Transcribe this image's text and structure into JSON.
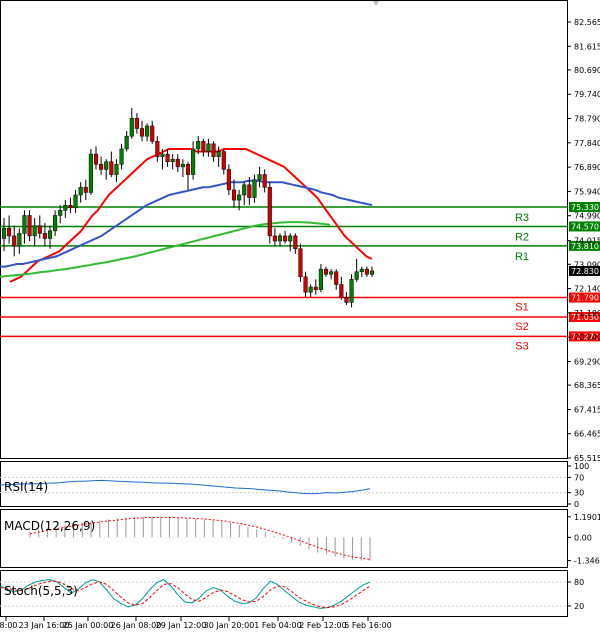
{
  "chart_data": [
    {
      "type": "candlestick",
      "title": "",
      "ylim": [
        65.515,
        83.0
      ],
      "grid": false,
      "price_axis_ticks": [
        "82.565",
        "81.615",
        "80.690",
        "79.740",
        "78.790",
        "77.840",
        "76.890",
        "75.940",
        "74.990",
        "74.015",
        "73.090",
        "72.140",
        "71.190",
        "70.240",
        "69.290",
        "68.365",
        "67.415",
        "66.465",
        "65.515"
      ],
      "time_axis_ticks": [
        "08:00",
        "23 Jan 16:00",
        "25 Jan 00:00",
        "26 Jan 08:00",
        "29 Jan 12:00",
        "30 Jan 20:00",
        "1 Feb 04:00",
        "2 Feb 12:00",
        "5 Feb 16:00"
      ],
      "candles": [
        [
          74.1,
          74.9,
          73.6,
          74.5
        ],
        [
          74.5,
          75.0,
          73.9,
          74.2
        ],
        [
          74.2,
          74.6,
          73.4,
          73.8
        ],
        [
          73.8,
          74.5,
          73.5,
          74.3
        ],
        [
          74.3,
          75.2,
          73.9,
          75.0
        ],
        [
          75.0,
          75.2,
          74.0,
          74.2
        ],
        [
          74.2,
          74.9,
          73.8,
          74.6
        ],
        [
          74.6,
          75.0,
          74.1,
          74.3
        ],
        [
          74.3,
          74.7,
          73.8,
          74.1
        ],
        [
          74.1,
          74.6,
          73.7,
          74.4
        ],
        [
          74.4,
          75.2,
          74.2,
          75.0
        ],
        [
          75.0,
          75.4,
          74.7,
          75.2
        ],
        [
          75.2,
          75.6,
          74.9,
          75.4
        ],
        [
          75.4,
          75.7,
          75.1,
          75.3
        ],
        [
          75.3,
          76.0,
          75.1,
          75.8
        ],
        [
          75.8,
          76.3,
          75.5,
          76.1
        ],
        [
          76.1,
          76.4,
          75.6,
          75.9
        ],
        [
          75.9,
          77.6,
          75.8,
          77.4
        ],
        [
          77.4,
          77.7,
          76.8,
          77.0
        ],
        [
          77.0,
          77.3,
          76.6,
          76.8
        ],
        [
          76.8,
          77.2,
          76.4,
          77.1
        ],
        [
          77.1,
          77.5,
          76.5,
          76.6
        ],
        [
          76.6,
          77.2,
          76.3,
          77.0
        ],
        [
          77.0,
          77.8,
          76.8,
          77.6
        ],
        [
          77.6,
          78.3,
          77.5,
          78.1
        ],
        [
          78.1,
          79.2,
          78.0,
          78.8
        ],
        [
          78.8,
          79.0,
          78.2,
          78.4
        ],
        [
          78.4,
          78.7,
          77.9,
          78.1
        ],
        [
          78.1,
          78.6,
          77.9,
          78.5
        ],
        [
          78.5,
          78.7,
          77.8,
          77.9
        ],
        [
          77.9,
          78.1,
          77.1,
          77.3
        ],
        [
          77.3,
          77.6,
          76.8,
          77.4
        ],
        [
          77.4,
          77.6,
          76.9,
          77.1
        ],
        [
          77.1,
          77.4,
          76.8,
          77.2
        ],
        [
          77.2,
          77.4,
          76.7,
          76.9
        ],
        [
          76.9,
          77.2,
          76.5,
          77.0
        ],
        [
          77.0,
          77.1,
          76.0,
          76.6
        ],
        [
          76.6,
          77.9,
          76.4,
          77.6
        ],
        [
          77.6,
          78.1,
          77.4,
          77.9
        ],
        [
          77.9,
          78.0,
          77.3,
          77.5
        ],
        [
          77.5,
          78.0,
          77.3,
          77.8
        ],
        [
          77.8,
          77.9,
          77.1,
          77.3
        ],
        [
          77.3,
          77.7,
          76.9,
          77.5
        ],
        [
          77.5,
          77.6,
          76.6,
          76.8
        ],
        [
          76.8,
          77.0,
          75.8,
          76.0
        ],
        [
          76.0,
          76.4,
          75.3,
          75.6
        ],
        [
          75.6,
          76.0,
          75.2,
          75.8
        ],
        [
          75.8,
          76.3,
          75.4,
          76.2
        ],
        [
          76.2,
          76.5,
          75.4,
          75.7
        ],
        [
          75.7,
          76.6,
          75.5,
          76.4
        ],
        [
          76.4,
          76.9,
          76.1,
          76.6
        ],
        [
          76.6,
          76.8,
          75.9,
          76.1
        ],
        [
          76.1,
          76.3,
          73.9,
          74.2
        ],
        [
          74.2,
          74.5,
          73.8,
          74.0
        ],
        [
          74.0,
          74.3,
          73.8,
          74.2
        ],
        [
          74.2,
          74.4,
          73.9,
          74.0
        ],
        [
          74.0,
          74.3,
          73.6,
          74.2
        ],
        [
          74.2,
          74.3,
          73.5,
          73.7
        ],
        [
          73.7,
          73.9,
          72.4,
          72.6
        ],
        [
          72.6,
          72.8,
          71.8,
          72.0
        ],
        [
          72.0,
          72.3,
          71.8,
          72.2
        ],
        [
          72.2,
          72.5,
          71.9,
          72.1
        ],
        [
          72.1,
          73.1,
          72.0,
          72.9
        ],
        [
          72.9,
          73.0,
          72.6,
          72.7
        ],
        [
          72.7,
          72.9,
          72.5,
          72.8
        ],
        [
          72.8,
          72.9,
          72.1,
          72.3
        ],
        [
          72.3,
          72.6,
          71.7,
          71.8
        ],
        [
          71.8,
          72.0,
          71.5,
          71.6
        ],
        [
          71.6,
          72.7,
          71.4,
          72.5
        ],
        [
          72.5,
          73.3,
          72.4,
          72.8
        ],
        [
          72.8,
          73.0,
          72.6,
          72.9
        ],
        [
          72.9,
          73.0,
          72.6,
          72.7
        ],
        [
          72.7,
          73.0,
          72.6,
          72.83
        ]
      ],
      "moving_averages": [
        {
          "color": "#ff0000",
          "values": [
            72.4,
            72.5,
            72.6,
            72.8,
            73.0,
            73.2,
            73.3,
            73.4,
            73.5,
            73.6,
            73.8,
            74.0,
            74.2,
            74.4,
            74.7,
            75.0,
            75.2,
            75.5,
            75.8,
            76.0,
            76.2,
            76.4,
            76.6,
            76.8,
            77.0,
            77.2,
            77.3,
            77.4,
            77.5,
            77.6,
            77.6,
            77.6,
            77.6,
            77.6,
            77.5,
            77.5,
            77.5,
            77.5,
            77.5,
            77.6,
            77.6,
            77.6,
            77.6,
            77.6,
            77.5,
            77.4,
            77.3,
            77.2,
            77.1,
            77.0,
            76.9,
            76.7,
            76.5,
            76.3,
            76.1,
            75.9,
            75.7,
            75.4,
            75.1,
            74.8,
            74.5,
            74.2,
            74.0,
            73.8,
            73.6,
            73.4,
            73.3
          ]
        },
        {
          "color": "#3355cc",
          "values": [
            73.0,
            73.0,
            73.05,
            73.1,
            73.1,
            73.15,
            73.2,
            73.25,
            73.3,
            73.35,
            73.4,
            73.5,
            73.6,
            73.7,
            73.8,
            73.9,
            74.0,
            74.1,
            74.2,
            74.35,
            74.5,
            74.65,
            74.8,
            74.95,
            75.1,
            75.25,
            75.4,
            75.5,
            75.6,
            75.7,
            75.8,
            75.85,
            75.9,
            75.95,
            76.0,
            76.05,
            76.1,
            76.1,
            76.15,
            76.2,
            76.25,
            76.3,
            76.3,
            76.3,
            76.35,
            76.35,
            76.35,
            76.3,
            76.3,
            76.3,
            76.3,
            76.25,
            76.2,
            76.15,
            76.1,
            76.05,
            76.0,
            75.9,
            75.85,
            75.8,
            75.7,
            75.65,
            75.6,
            75.55,
            75.5,
            75.45,
            75.4
          ]
        },
        {
          "color": "#33bb33",
          "values": [
            72.6,
            72.62,
            72.64,
            72.66,
            72.68,
            72.7,
            72.72,
            72.75,
            72.78,
            72.8,
            72.82,
            72.85,
            72.88,
            72.9,
            72.93,
            72.96,
            73.0,
            73.03,
            73.06,
            73.1,
            73.13,
            73.16,
            73.2,
            73.24,
            73.28,
            73.32,
            73.36,
            73.4,
            73.45,
            73.5,
            73.55,
            73.6,
            73.65,
            73.7,
            73.75,
            73.8,
            73.85,
            73.9,
            73.95,
            74.0,
            74.05,
            74.1,
            74.15,
            74.2,
            74.25,
            74.3,
            74.35,
            74.4,
            74.45,
            74.5,
            74.55,
            74.6,
            74.63,
            74.66,
            74.68,
            74.7,
            74.72,
            74.73,
            74.74,
            74.74,
            74.74,
            74.73,
            74.72,
            74.7,
            74.68,
            74.66,
            74.64
          ]
        }
      ],
      "levels": [
        {
          "name": "R3",
          "value": 75.33,
          "tag": "75.330",
          "color": "#008000"
        },
        {
          "name": "R2",
          "value": 74.57,
          "tag": "74.570",
          "color": "#008000"
        },
        {
          "name": "R1",
          "value": 73.81,
          "tag": "73.810",
          "color": "#008000"
        },
        {
          "name": "S1",
          "value": 71.79,
          "tag": "71.790",
          "color": "#ff0000"
        },
        {
          "name": "S2",
          "value": 71.03,
          "tag": "71.030",
          "color": "#ff0000"
        },
        {
          "name": "S3",
          "value": 70.27,
          "tag": "70.270",
          "color": "#ff0000"
        }
      ],
      "current_price": {
        "value": 72.83,
        "tag": "72.830"
      }
    },
    {
      "type": "line",
      "title": "RSI(14)",
      "ylim": [
        0,
        100
      ],
      "ticks": [
        "100",
        "70",
        "30",
        "0"
      ],
      "series": [
        {
          "color": "#1e6fd0",
          "values": [
            50,
            51,
            52,
            53,
            53,
            54,
            55,
            56,
            58,
            60,
            60,
            61,
            62,
            61,
            60,
            59,
            58,
            57,
            56,
            55,
            55,
            54,
            53,
            52,
            50,
            48,
            46,
            44,
            42,
            41,
            40,
            38,
            36,
            35,
            32,
            30,
            28,
            27,
            28,
            30,
            29,
            31,
            33,
            36,
            40
          ]
        }
      ]
    },
    {
      "type": "bar",
      "title": "MACD(12,26,9)",
      "ylim": [
        -1.6,
        1.35
      ],
      "ticks": [
        "1.1901",
        "0.00",
        "-1.346"
      ],
      "series": [
        {
          "type": "histogram",
          "color": "#999999",
          "values": [
            0.35,
            0.45,
            0.55,
            0.62,
            0.7,
            0.78,
            0.85,
            0.92,
            0.98,
            1.04,
            1.1,
            1.15,
            1.18,
            1.19,
            1.19,
            1.18,
            1.16,
            1.13,
            1.1,
            1.06,
            1.02,
            0.97,
            0.9,
            0.82,
            0.72,
            0.6,
            0.45,
            0.28,
            0.1,
            -0.1,
            -0.3,
            -0.5,
            -0.7,
            -0.88,
            -1.0,
            -1.12,
            -1.22,
            -1.3,
            -1.34,
            -1.35
          ]
        },
        {
          "type": "signal",
          "color": "#ff0000",
          "values": [
            0.2,
            0.3,
            0.4,
            0.5,
            0.58,
            0.66,
            0.74,
            0.82,
            0.88,
            0.95,
            1.0,
            1.06,
            1.1,
            1.13,
            1.15,
            1.16,
            1.15,
            1.14,
            1.12,
            1.09,
            1.06,
            1.01,
            0.96,
            0.89,
            0.81,
            0.71,
            0.6,
            0.46,
            0.31,
            0.15,
            -0.02,
            -0.2,
            -0.39,
            -0.57,
            -0.74,
            -0.89,
            -1.02,
            -1.13,
            -1.21,
            -1.27
          ]
        }
      ]
    },
    {
      "type": "line",
      "title": "Stoch(5,5,3)",
      "ylim": [
        0,
        100
      ],
      "ticks": [
        "80",
        "20"
      ],
      "series": [
        {
          "color": "#009999",
          "values": [
            70,
            62,
            55,
            60,
            72,
            80,
            84,
            86,
            80,
            66,
            52,
            62,
            78,
            86,
            80,
            60,
            38,
            26,
            18,
            22,
            38,
            60,
            78,
            86,
            70,
            48,
            30,
            28,
            40,
            58,
            66,
            60,
            44,
            32,
            26,
            28,
            40,
            64,
            82,
            74,
            58,
            44,
            30,
            22,
            18,
            14,
            16,
            22,
            32,
            46,
            60,
            72,
            80
          ]
        },
        {
          "color": "#ff0000",
          "dash": true,
          "values": [
            66,
            64,
            60,
            58,
            64,
            72,
            78,
            82,
            82,
            75,
            64,
            58,
            66,
            76,
            80,
            74,
            58,
            42,
            28,
            22,
            26,
            40,
            58,
            74,
            76,
            66,
            50,
            36,
            32,
            42,
            54,
            60,
            56,
            46,
            36,
            30,
            32,
            44,
            60,
            70,
            68,
            56,
            42,
            32,
            24,
            18,
            16,
            18,
            24,
            34,
            46,
            58,
            70
          ]
        }
      ]
    }
  ]
}
